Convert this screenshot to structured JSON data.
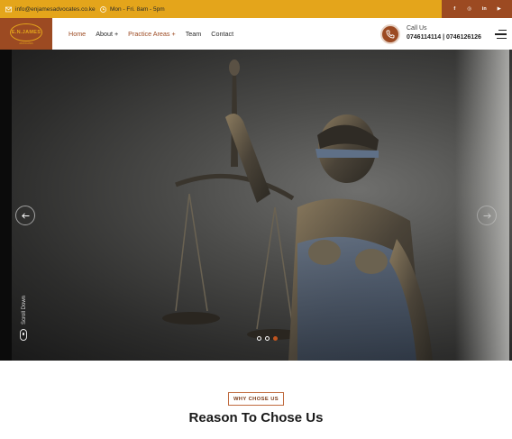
{
  "topbar": {
    "email": "info@enjamesadvocates.co.ke",
    "hours": "Mon - Fri. 8am - 5pm",
    "social": [
      {
        "icon": "facebook-icon",
        "glyph": "f"
      },
      {
        "icon": "instagram-icon",
        "glyph": "◎"
      },
      {
        "icon": "linkedin-icon",
        "glyph": "in"
      },
      {
        "icon": "youtube-icon",
        "glyph": "▶"
      }
    ]
  },
  "nav": {
    "logo_text": "E.N.JAMES",
    "logo_sub": "ADVOCATES",
    "menu": [
      {
        "label": "Home",
        "active": true
      },
      {
        "label": "About +",
        "active": false
      },
      {
        "label": "Practice Areas +",
        "active": true
      },
      {
        "label": "Team",
        "active": false
      },
      {
        "label": "Contact",
        "active": false
      }
    ],
    "call_label": "Call Us",
    "call_numbers": "0746114114 | 0746126126"
  },
  "hero": {
    "scroll_label": "Scroll Down",
    "slides_count": 3,
    "active_slide": 3
  },
  "section": {
    "badge": "WHY CHOSE US",
    "title": "Reason To Chose Us"
  },
  "colors": {
    "accent_gold": "#e4a51b",
    "accent_brown": "#9c4a22",
    "dot_active": "#c0541f"
  }
}
